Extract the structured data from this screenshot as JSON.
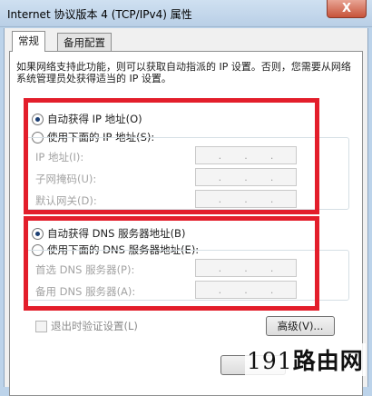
{
  "window": {
    "title": "Internet 协议版本 4 (TCP/IPv4) 属性",
    "close_label": "X"
  },
  "tabs": [
    {
      "label": "常规"
    },
    {
      "label": "备用配置"
    }
  ],
  "intro_text": "如果网络支持此功能，则可以获取自动指派的 IP 设置。否则，您需要从网络系统管理员处获得适当的 IP 设置。",
  "ip_section": {
    "auto_label": "自动获得 IP 地址(O)",
    "manual_label": "使用下面的 IP 地址(S):",
    "fields": [
      {
        "label": "IP 地址(I):",
        "value": ". . ."
      },
      {
        "label": "子网掩码(U):",
        "value": ". . ."
      },
      {
        "label": "默认网关(D):",
        "value": ". . ."
      }
    ]
  },
  "dns_section": {
    "auto_label": "自动获得 DNS 服务器地址(B)",
    "manual_label": "使用下面的 DNS 服务器地址(E):",
    "fields": [
      {
        "label": "首选 DNS 服务器(P):",
        "value": ". . ."
      },
      {
        "label": "备用 DNS 服务器(A):",
        "value": ". . ."
      }
    ]
  },
  "validate_label": "退出时验证设置(L)",
  "advanced_label": "高级(V)...",
  "watermark": {
    "digits": "191",
    "text": "路由网"
  },
  "colors": {
    "highlight": "#e31e2b",
    "titlebar": "#bcd3ea"
  }
}
